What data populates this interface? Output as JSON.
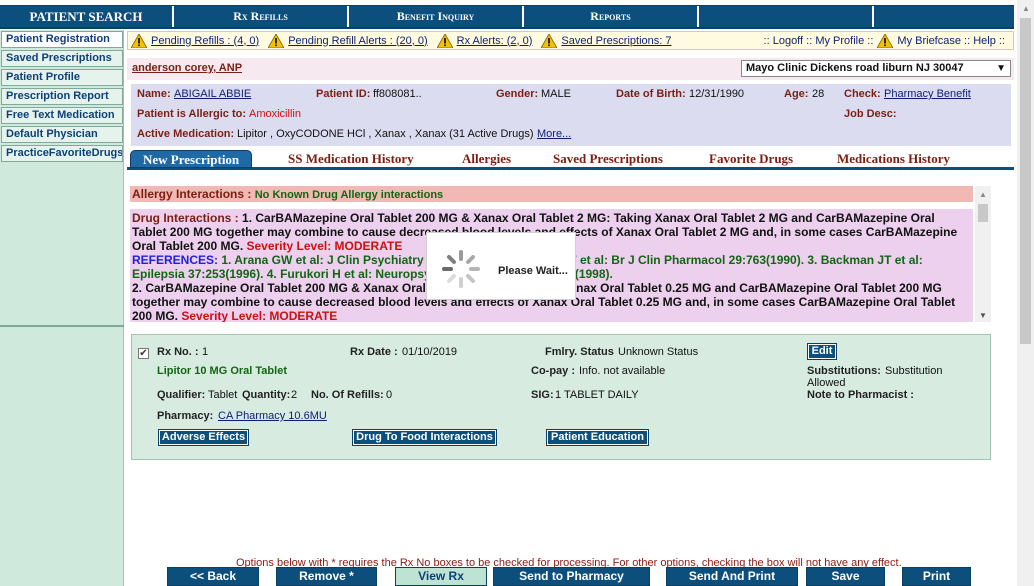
{
  "topnav": [
    "PATIENT SEARCH",
    "Rx Refills",
    "Benefit Inquiry",
    "Reports",
    "",
    ""
  ],
  "sidebar": [
    "Patient Registration",
    "Saved Prescriptions",
    "Patient Profile",
    "Prescription Report",
    "Free Text Medication",
    "Default Physician",
    "PracticeFavoriteDrugs"
  ],
  "alerts": {
    "pending_refills": "Pending Refills : (4, 0)",
    "pending_refill_alerts": "Pending Refill Alerts : (20, 0)",
    "rx_alerts": "Rx Alerts: (2, 0)",
    "saved_prescriptions": "Saved Prescriptions: 7",
    "logoff": ":: Logoff :: My Profile ::",
    "briefcase": "My Briefcase :: Help ::"
  },
  "provider": {
    "name": "anderson corey, ANP",
    "location": "Mayo Clinic Dickens road liburn NJ 30047"
  },
  "patient": {
    "name_label": "Name:",
    "name": "ABIGAIL ABBIE",
    "id_label": "Patient ID:",
    "id": "ff808081..",
    "gender_label": "Gender:",
    "gender": "MALE",
    "dob_label": "Date of Birth:",
    "dob": "12/31/1990",
    "age_label": "Age:",
    "age": "28",
    "check_label": "Check:",
    "check": "Pharmacy Benefit",
    "allergic_label": "Patient is Allergic to:",
    "allergic": "Amoxicillin",
    "jobdesc_label": "Job Desc:",
    "active_label": "Active Medication:",
    "active": "Lipitor , OxyCODONE HCl , Xanax , Xanax (31 Active Drugs)",
    "more": "More..."
  },
  "tabs": [
    "New Prescription",
    "SS Medication History",
    "Allergies",
    "Saved Prescriptions",
    "Favorite Drugs",
    "Medications History"
  ],
  "interactions": {
    "allergy_label": "Allergy Interactions :",
    "allergy_value": "No Known Drug Allergy interactions",
    "drug_label": "Drug Interactions :",
    "item1": "1. CarBAMazepine Oral Tablet 200 MG & Xanax Oral Tablet 2 MG: Taking Xanax Oral Tablet 2 MG and CarBAMazepine Oral Tablet 200 MG together may combine to cause decreased blood levels and effects of Xanax Oral Tablet 2 MG and, in some cases CarBAMazepine Oral Tablet 200 MG.",
    "severity1": "Severity Level: MODERATE",
    "refs_label": "REFERENCES:",
    "refs": "1. Arana GW et al: J Clin Psychiatry 46:344(1985). 2. Arana GW et al: Br J Clin Pharmacol 29:763(1990). 3. Backman JT et al: Epilepsia 37:253(1996). 4. Furukori H et al: Neuropsychopharmacology 18:364(1998).",
    "item2": "2. CarBAMazepine Oral Tablet 200 MG & Xanax Oral Tablet 0.25 MG: Taking Xanax Oral Tablet 0.25 MG and CarBAMazepine Oral Tablet 200 MG together may combine to cause decreased blood levels and effects of Xanax Oral Tablet 0.25 MG and, in some cases CarBAMazepine Oral Tablet 200 MG.",
    "severity2": "Severity Level: MODERATE"
  },
  "wait": "Please Wait...",
  "rx": {
    "rxno_label": "Rx No. :",
    "rxno": "1",
    "rxdate_label": "Rx Date :",
    "rxdate": "01/10/2019",
    "status_label": "Fmlry. Status",
    "status": "Unknown Status",
    "edit": "Edit",
    "drug": "Lipitor 10 MG Oral Tablet",
    "copay_label": "Co-pay :",
    "copay": "Info. not available",
    "subst_label": "Substitutions:",
    "subst": "Substitution Allowed",
    "qualifier_label": "Qualifier:",
    "qualifier": "Tablet",
    "qty_label": "Quantity:",
    "qty": "2",
    "refills_label": "No. Of Refills:",
    "refills": "0",
    "sig_label": "SIG:",
    "sig": "1 TABLET DAILY",
    "note_label": "Note to Pharmacist :",
    "pharmacy_label": "Pharmacy:",
    "pharmacy": "CA Pharmacy 10.6MU",
    "btn_adverse": "Adverse Effects",
    "btn_food": "Drug To Food Interactions",
    "btn_edu": "Patient Education"
  },
  "bottom": {
    "note": "Options below with * requires the Rx No boxes to be checked for processing. For other options, checking the box will not have any effect.",
    "buttons": [
      "<< Back",
      "Remove *",
      "View Rx",
      "Send to Pharmacy",
      "Send And Print",
      "Save",
      "Print"
    ]
  }
}
